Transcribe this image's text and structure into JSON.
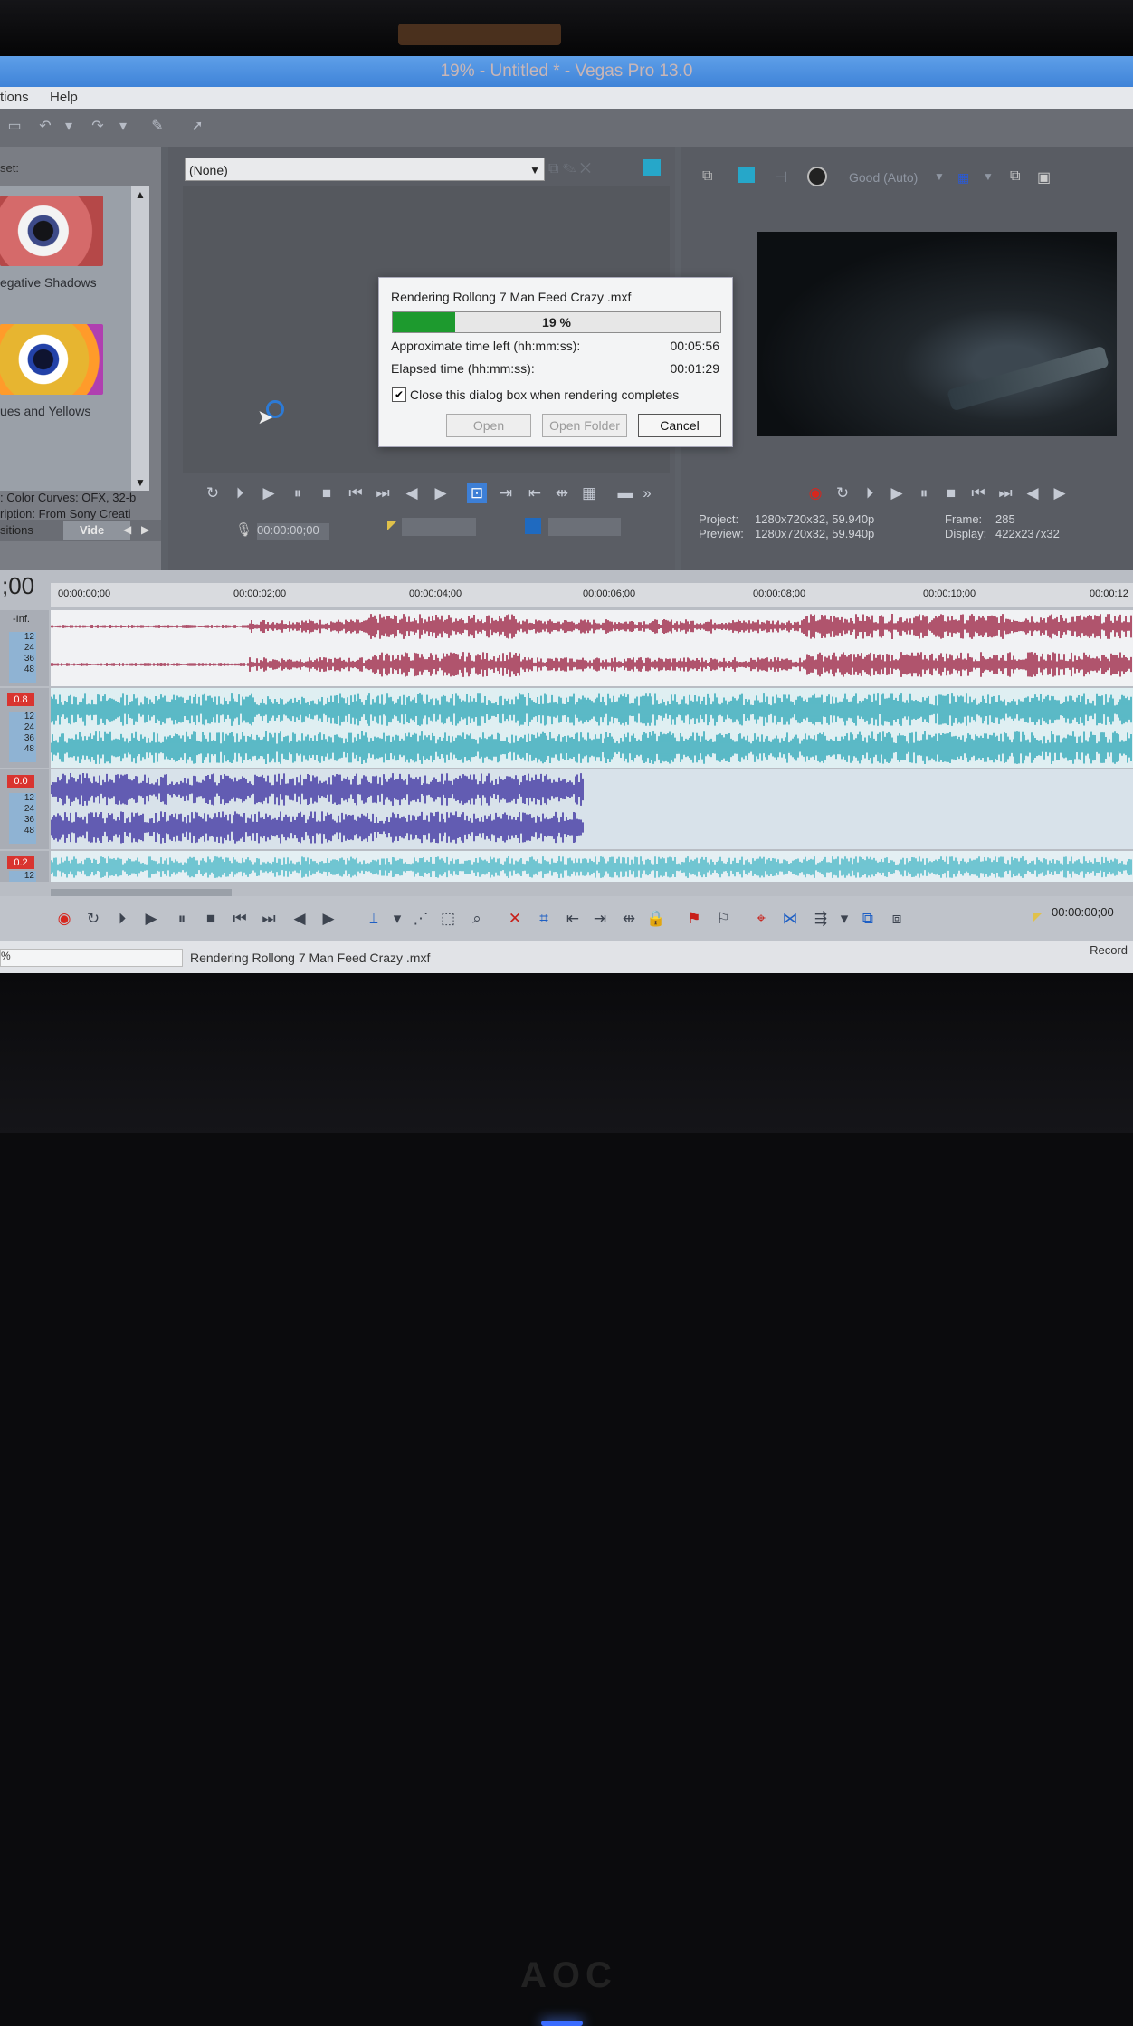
{
  "window": {
    "title": "19% - Untitled * - Vegas Pro 13.0"
  },
  "menu": {
    "items": [
      "tions",
      "Help"
    ]
  },
  "fx_panel": {
    "preset_label": "set:",
    "presets": [
      {
        "label": "egative Shadows"
      },
      {
        "label": "ues and Yellows"
      }
    ],
    "desc_line1": ": Color Curves: OFX, 32-b",
    "desc_line2": "ription: From Sony Creati",
    "tab_left": "sitions",
    "tab_active": "Vide"
  },
  "trimmer": {
    "dropdown_value": "(None)",
    "timecode": "00:00:00;00"
  },
  "preview": {
    "quality": "Good (Auto)",
    "project_label": "Project:",
    "project_value": "1280x720x32, 59.940p",
    "preview_label": "Preview:",
    "preview_value": "1280x720x32, 59.940p",
    "frame_label": "Frame:",
    "frame_value": "285",
    "display_label": "Display:",
    "display_value": "422x237x32"
  },
  "render_dialog": {
    "title": "Rendering Rollong 7 Man Feed Crazy .mxf",
    "progress_percent": 19,
    "progress_text": "19 %",
    "time_left_label": "Approximate time left (hh:mm:ss):",
    "time_left_value": "00:05:56",
    "elapsed_label": "Elapsed time (hh:mm:ss):",
    "elapsed_value": "00:01:29",
    "close_checkbox_label": "Close this dialog box when rendering completes",
    "close_checked": true,
    "open_button": "Open",
    "open_folder_button": "Open Folder",
    "cancel_button": "Cancel"
  },
  "timeline": {
    "cursor_time": ";00",
    "ruler_ticks": [
      "00:00:00;00",
      "00:00:02;00",
      "00:00:04;00",
      "00:00:06;00",
      "00:00:08;00",
      "00:00:10;00",
      "00:00:12"
    ],
    "tracks": [
      {
        "volume": "",
        "peak": "-Inf.",
        "meter": [
          "12",
          "24",
          "36",
          "48"
        ],
        "color": "#9b2040"
      },
      {
        "volume": "0.8",
        "peak": "",
        "meter": [
          "12",
          "24",
          "36",
          "48"
        ],
        "color": "#2fa7b7"
      },
      {
        "volume": "0.0",
        "peak": "",
        "meter": [
          "12",
          "24",
          "36",
          "48"
        ],
        "color": "#3b2fa0"
      },
      {
        "volume": "0.2",
        "peak": "",
        "meter": [
          "12"
        ],
        "color": "#4ab7c6"
      }
    ]
  },
  "bottom": {
    "timecode": "00:00:00;00",
    "status_message": "Rendering Rollong 7 Man Feed Crazy .mxf",
    "status_left": "%",
    "record_label": "Record"
  },
  "colors": {
    "titlebar": "#4a8ee0",
    "progress": "#1d9a2e",
    "record": "#d7261e"
  }
}
